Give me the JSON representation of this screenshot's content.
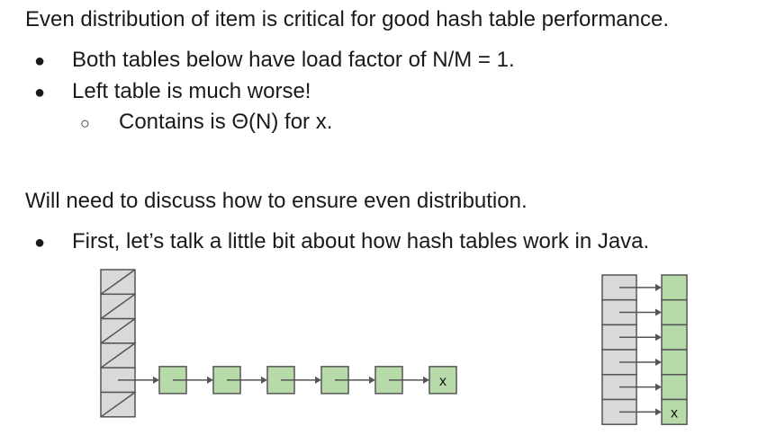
{
  "heading1": "Even distribution of item is critical for good hash table performance.",
  "bullets1": [
    "Both tables below have load factor of N/M = 1.",
    "Left table is much worse!"
  ],
  "subbullet": "Contains is Θ(N) for x.",
  "heading2": "Will need to discuss how to ensure even distribution.",
  "bullets2": [
    "First, let’s talk a little bit about how hash tables work in Java."
  ],
  "diagram": {
    "left_table": {
      "buckets": 6,
      "chain_length": 6,
      "chain_bucket": 5
    },
    "right_table": {
      "buckets": 6
    },
    "node_label": "x",
    "colors": {
      "bucket": "#d9d9d9",
      "node": "#b7dba8",
      "stroke": "#555555"
    }
  }
}
